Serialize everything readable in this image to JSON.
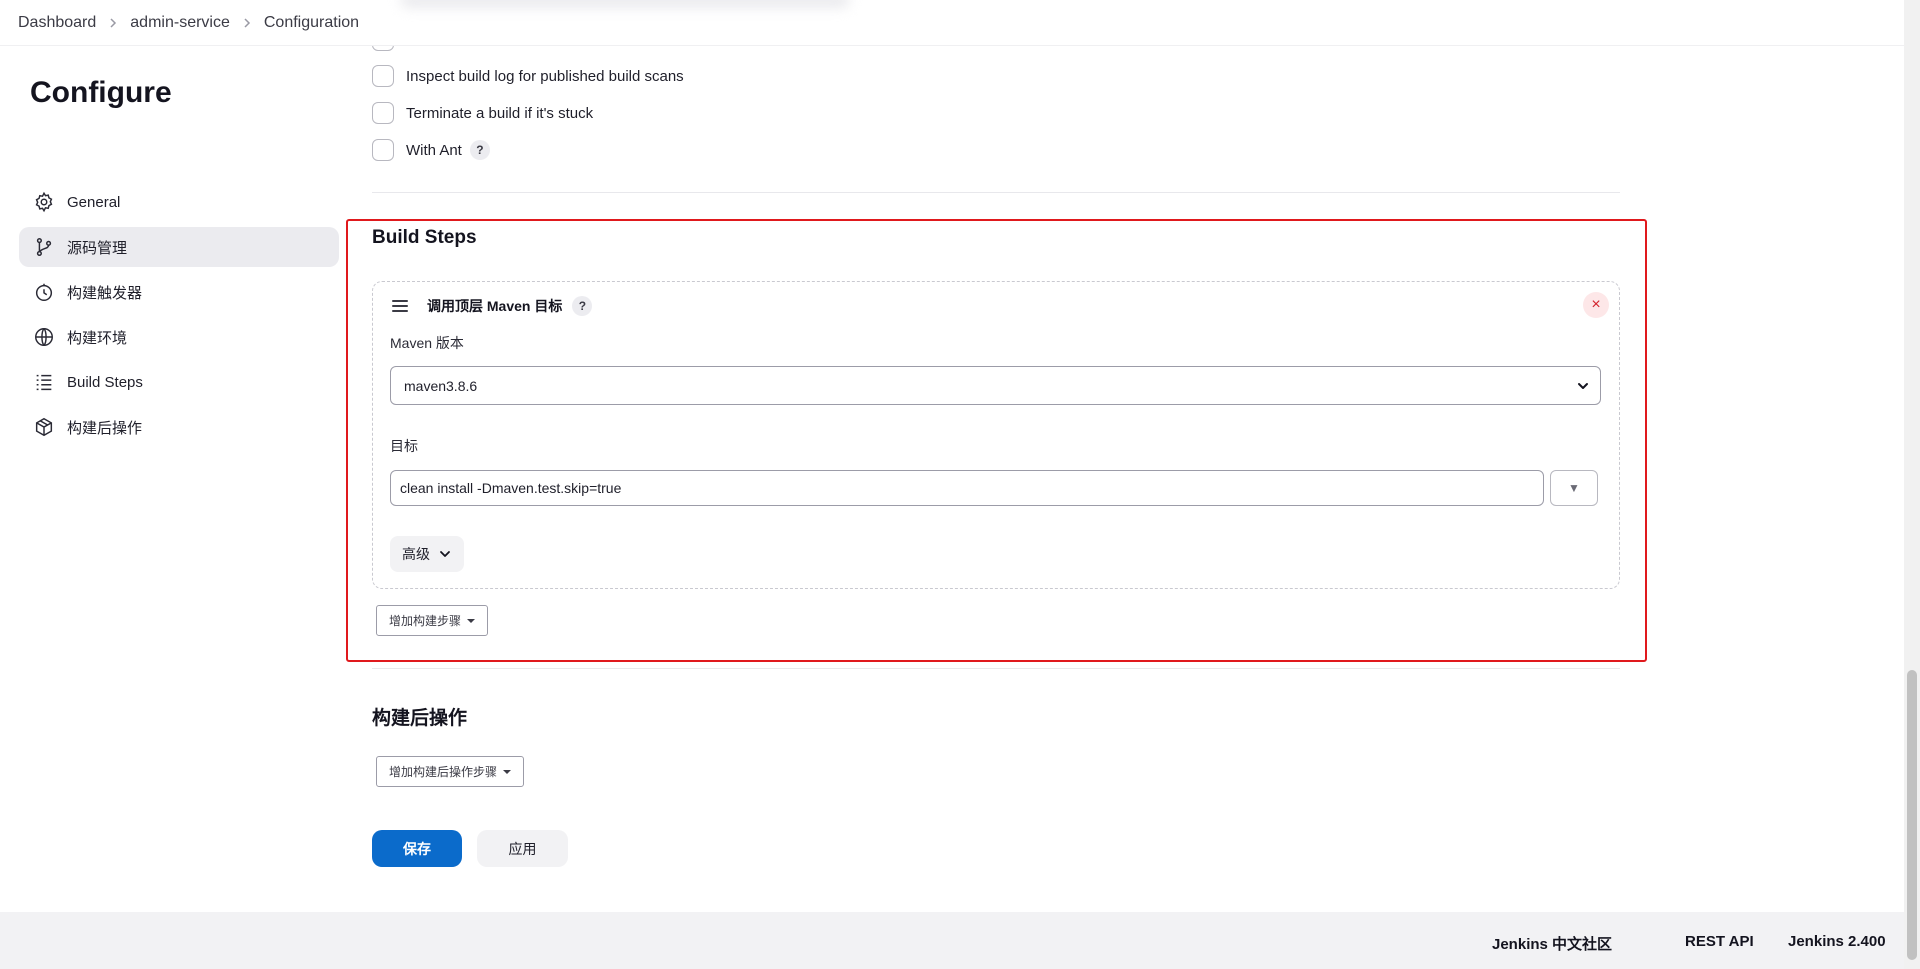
{
  "breadcrumb": {
    "items": [
      "Dashboard",
      "admin-service",
      "Configuration"
    ]
  },
  "sidebar": {
    "title": "Configure",
    "items": [
      {
        "label": "General",
        "icon": "gear-icon"
      },
      {
        "label": "源码管理",
        "icon": "git-branch-icon",
        "active": true
      },
      {
        "label": "构建触发器",
        "icon": "clock-icon"
      },
      {
        "label": "构建环境",
        "icon": "globe-icon"
      },
      {
        "label": "Build Steps",
        "icon": "list-icon"
      },
      {
        "label": "构建后操作",
        "icon": "package-icon"
      }
    ]
  },
  "build_env_options": [
    {
      "label": "Inspect build log for published build scans",
      "checked": false
    },
    {
      "label": "Terminate a build if it's stuck",
      "checked": false
    },
    {
      "label": "With Ant",
      "checked": false,
      "help": "?"
    }
  ],
  "build_steps": {
    "title": "Build Steps",
    "step": {
      "title": "调用顶层 Maven 目标",
      "help": "?",
      "close": "×",
      "maven_version_label": "Maven 版本",
      "maven_version_value": "maven3.8.6",
      "goals_label": "目标",
      "goals_value": "clean install -Dmaven.test.skip=true",
      "expand_glyph": "▼",
      "advanced_label": "高级"
    },
    "add_step_label": "增加构建步骤"
  },
  "post_build": {
    "title": "构建后操作",
    "add_label": "增加构建后操作步骤"
  },
  "actions": {
    "save": "保存",
    "apply": "应用"
  },
  "footer": {
    "community": "Jenkins 中文社区",
    "rest_api": "REST API",
    "version": "Jenkins 2.400"
  },
  "colors": {
    "primary": "#0b6bcb",
    "highlight": "#e0191d",
    "danger": "#d3212c"
  }
}
